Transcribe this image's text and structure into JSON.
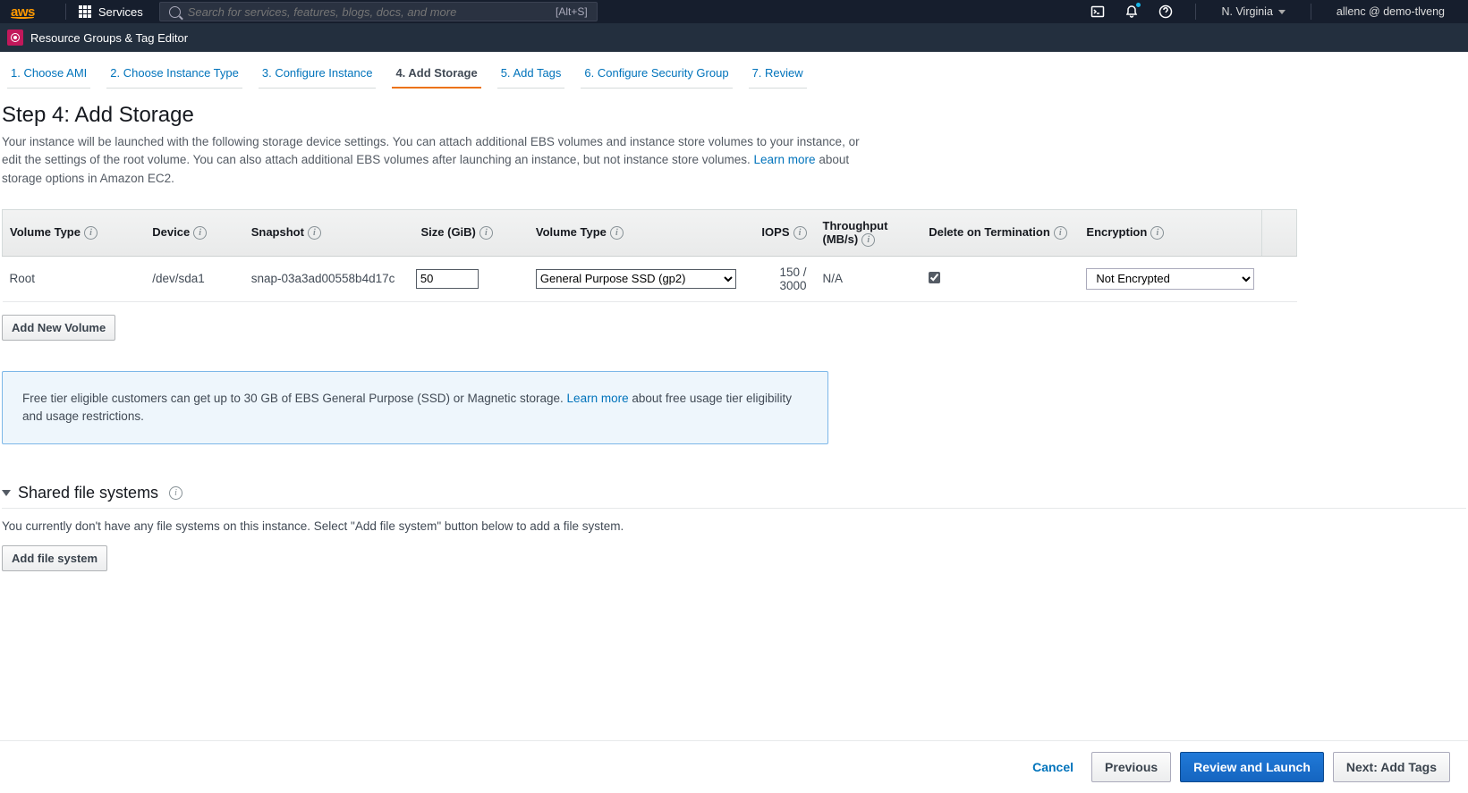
{
  "topnav": {
    "services_label": "Services",
    "search_placeholder": "Search for services, features, blogs, docs, and more",
    "search_hint": "[Alt+S]",
    "region": "N. Virginia",
    "account": "allenc @ demo-tlveng"
  },
  "subnav": {
    "label": "Resource Groups & Tag Editor"
  },
  "wizard": {
    "steps": [
      {
        "label": "1. Choose AMI",
        "active": false
      },
      {
        "label": "2. Choose Instance Type",
        "active": false
      },
      {
        "label": "3. Configure Instance",
        "active": false
      },
      {
        "label": "4. Add Storage",
        "active": true
      },
      {
        "label": "5. Add Tags",
        "active": false
      },
      {
        "label": "6. Configure Security Group",
        "active": false
      },
      {
        "label": "7. Review",
        "active": false
      }
    ]
  },
  "page": {
    "title": "Step 4: Add Storage",
    "description_a": "Your instance will be launched with the following storage device settings. You can attach additional EBS volumes and instance store volumes to your instance, or edit the settings of the root volume. You can also attach additional EBS volumes after launching an instance, but not instance store volumes. ",
    "learn_more": "Learn more",
    "description_b": " about storage options in Amazon EC2."
  },
  "table": {
    "headers": {
      "vol_type_a": "Volume Type",
      "device": "Device",
      "snapshot": "Snapshot",
      "size": "Size (GiB)",
      "vol_type_b": "Volume Type",
      "iops": "IOPS",
      "throughput": "Throughput (MB/s)",
      "delete": "Delete on Termination",
      "encryption": "Encryption"
    },
    "row": {
      "vt": "Root",
      "device": "/dev/sda1",
      "snapshot": "snap-03a3ad00558b4d17c",
      "size": "50",
      "vol_select": "General Purpose SSD (gp2)",
      "iops": "150 / 3000",
      "throughput": "N/A",
      "delete_checked": true,
      "encryption": "Not Encrypted"
    },
    "add_volume": "Add New Volume"
  },
  "info_box": {
    "text_a": "Free tier eligible customers can get up to 30 GB of EBS General Purpose (SSD) or Magnetic storage. ",
    "learn_more": "Learn more",
    "text_b": " about free usage tier eligibility and usage restrictions."
  },
  "sfs": {
    "title": "Shared file systems",
    "desc": "You currently don't have any file systems on this instance. Select \"Add file system\" button below to add a file system.",
    "add_button": "Add file system"
  },
  "footer": {
    "cancel": "Cancel",
    "previous": "Previous",
    "review": "Review and Launch",
    "next": "Next: Add Tags"
  }
}
